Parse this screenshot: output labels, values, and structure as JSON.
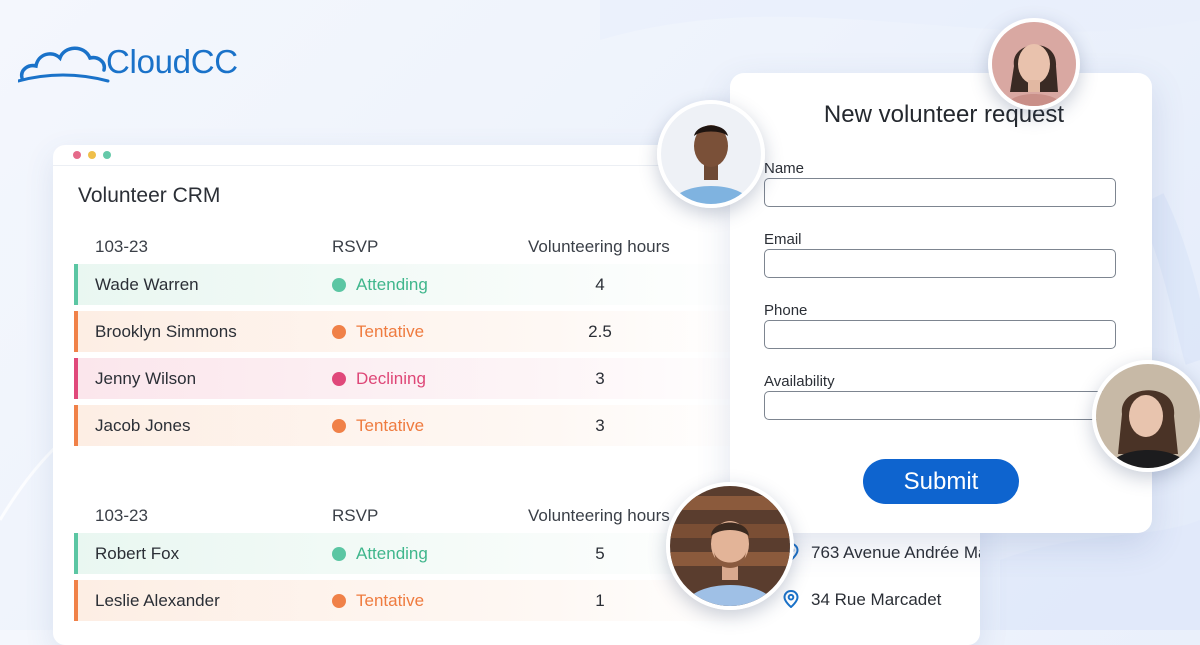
{
  "brand": {
    "name": "CloudCC",
    "color": "#1a72c9"
  },
  "crm": {
    "title": "Volunteer CRM",
    "tables": [
      {
        "headers": {
          "id": "103-23",
          "rsvp": "RSVP",
          "hours": "Volunteering hours"
        },
        "rows": [
          {
            "name": "Wade Warren",
            "status": "Attending",
            "hours": "4"
          },
          {
            "name": "Brooklyn Simmons",
            "status": "Tentative",
            "hours": "2.5"
          },
          {
            "name": "Jenny Wilson",
            "status": "Declining",
            "hours": "3"
          },
          {
            "name": "Jacob Jones",
            "status": "Tentative",
            "hours": "3"
          }
        ]
      },
      {
        "headers": {
          "id": "103-23",
          "rsvp": "RSVP",
          "hours": "Volunteering hours"
        },
        "rows": [
          {
            "name": "Robert Fox",
            "status": "Attending",
            "hours": "5"
          },
          {
            "name": "Leslie Alexander",
            "status": "Tentative",
            "hours": "1"
          }
        ]
      }
    ],
    "addresses": [
      "763 Avenue Andrée Ma",
      "34 Rue Marcadet"
    ]
  },
  "status_colors": {
    "Attending": "#5bc6a3",
    "Tentative": "#f08148",
    "Declining": "#e0487a"
  },
  "form": {
    "title": "New volunteer request",
    "fields": {
      "name": {
        "label": "Name",
        "value": ""
      },
      "email": {
        "label": "Email",
        "value": ""
      },
      "phone": {
        "label": "Phone",
        "value": ""
      },
      "availability": {
        "label": "Availability",
        "value": ""
      }
    },
    "submit_label": "Submit",
    "accent": "#0e64cf"
  },
  "icons": {
    "address": "map-pin-icon",
    "logo": "cloud-icon"
  }
}
